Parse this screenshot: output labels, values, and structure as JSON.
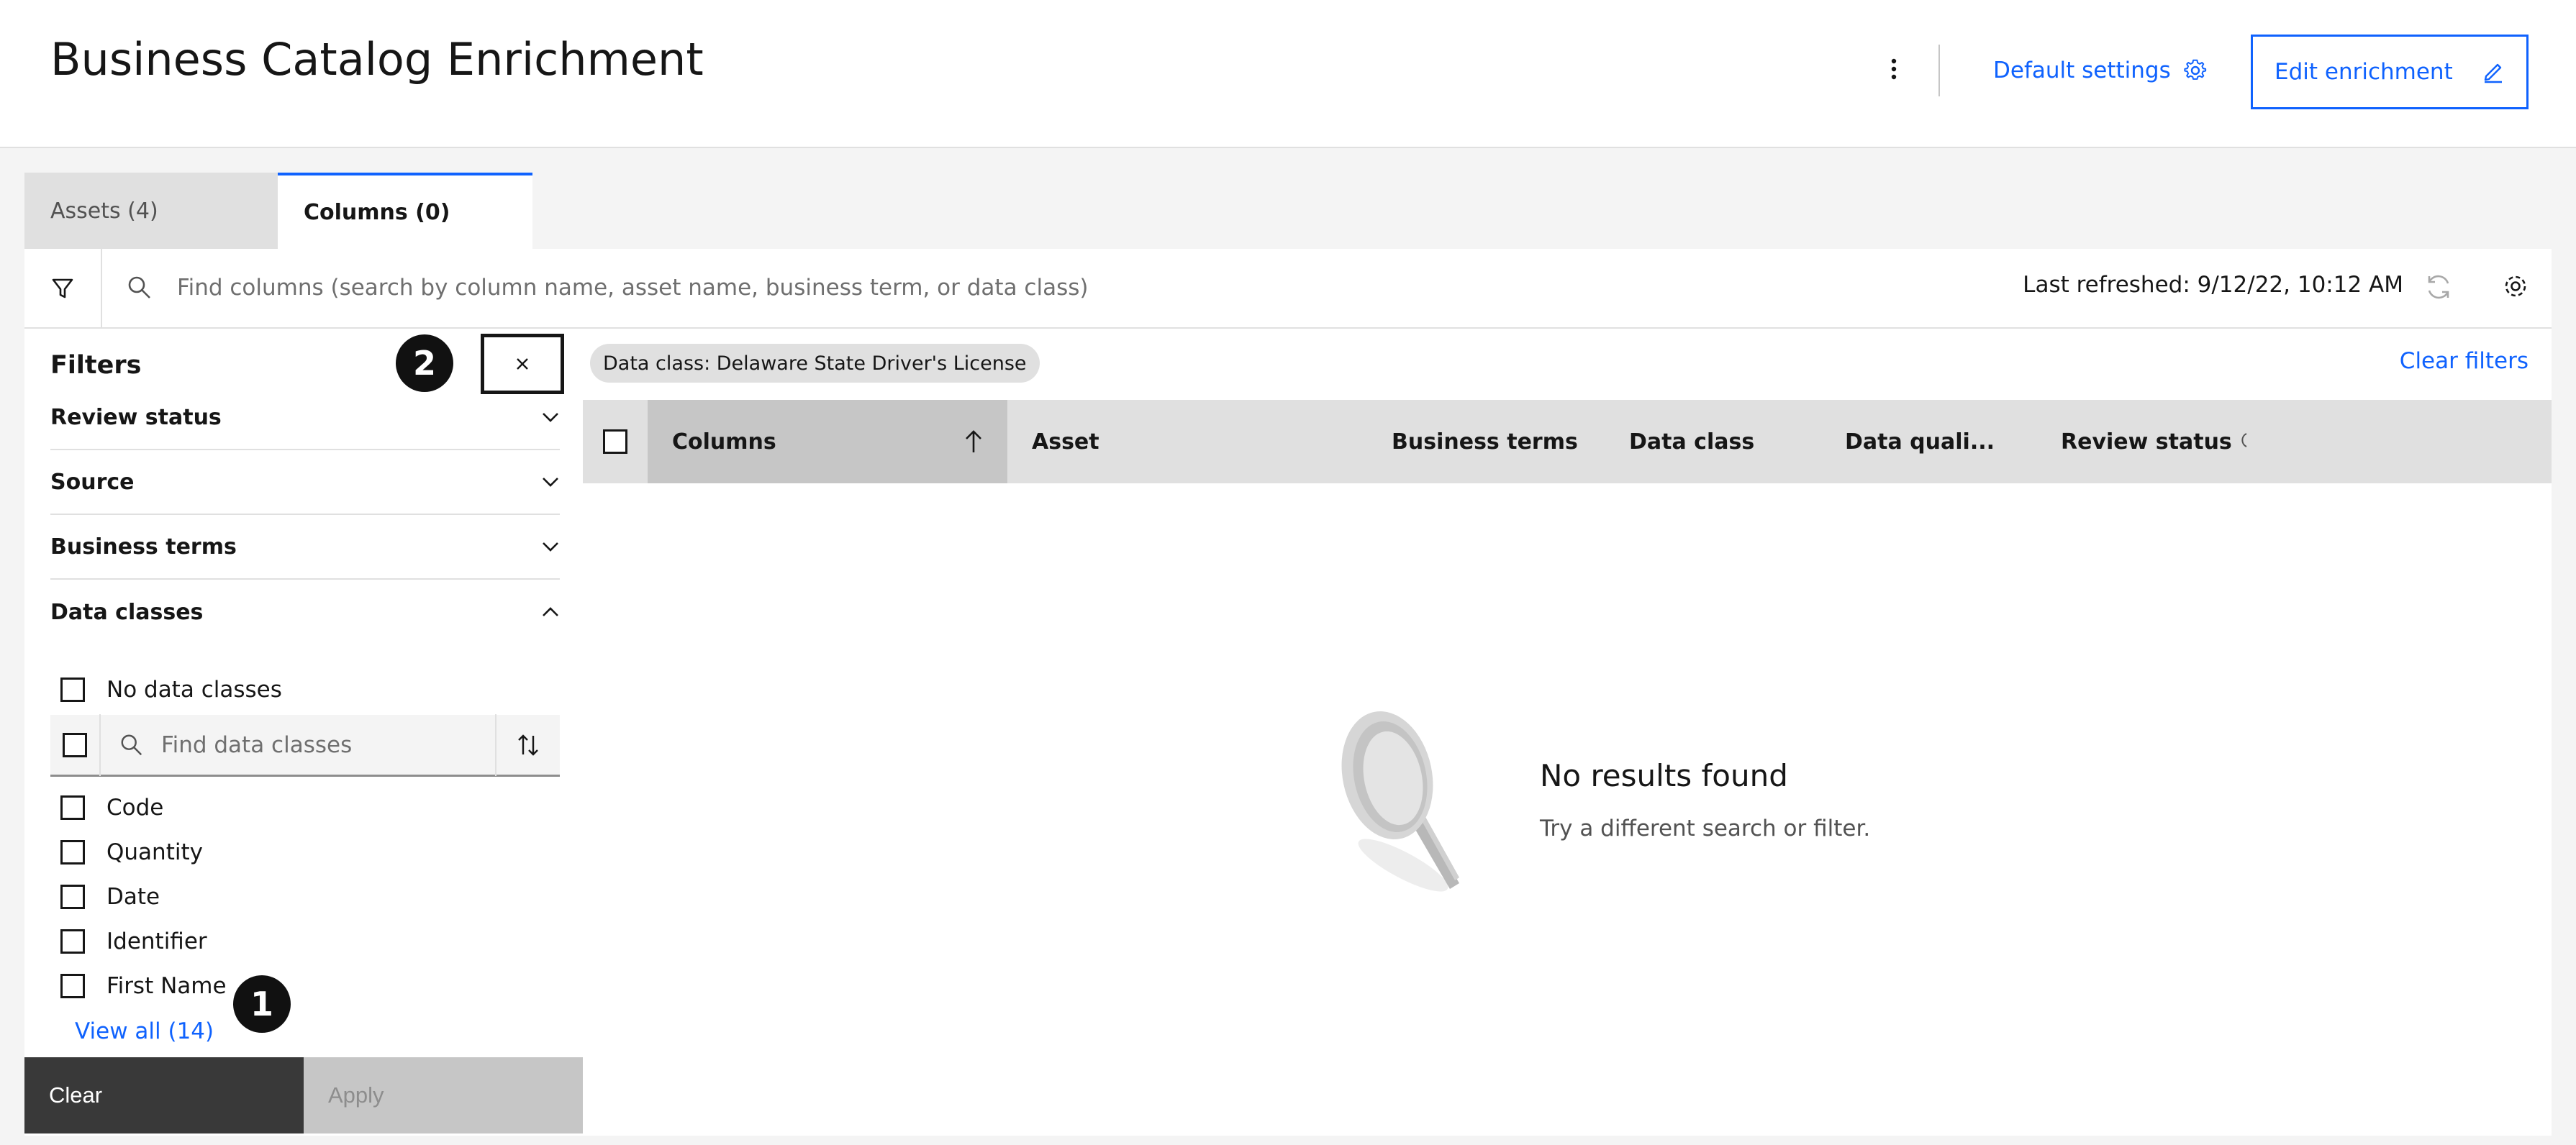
{
  "header": {
    "title": "Business Catalog Enrichment",
    "default_settings_label": "Default settings",
    "edit_enrichment_label": "Edit enrichment"
  },
  "tabs": [
    {
      "label": "Assets (4)",
      "active": false
    },
    {
      "label": "Columns (0)",
      "active": true
    }
  ],
  "toolbar": {
    "search_placeholder": "Find columns (search by column name, asset name, business term, or data class)",
    "last_refreshed": "Last refreshed: 9/12/22, 10:12 AM"
  },
  "filters": {
    "title": "Filters",
    "sections": [
      {
        "label": "Review status",
        "expanded": false
      },
      {
        "label": "Source",
        "expanded": false
      },
      {
        "label": "Business terms",
        "expanded": false
      },
      {
        "label": "Data classes",
        "expanded": true
      }
    ],
    "no_data_classes_label": "No data classes",
    "data_class_search_placeholder": "Find data classes",
    "data_class_options": [
      "Code",
      "Quantity",
      "Date",
      "Identifier",
      "First Name"
    ],
    "view_all_label": "View all (14)",
    "clear_label": "Clear",
    "apply_label": "Apply"
  },
  "callouts": [
    "1",
    "2"
  ],
  "active_filter_tag": "Data class: Delaware State Driver's License",
  "clear_filters_label": "Clear filters",
  "table": {
    "headers": [
      "Columns",
      "Asset",
      "Business terms",
      "Data class",
      "Data quali...",
      "Review status"
    ],
    "sort_column": "Columns",
    "sort_direction": "ascending"
  },
  "empty_state": {
    "title": "No results found",
    "subtitle": "Try a different search or filter."
  },
  "colors": {
    "accent": "#0f62fe",
    "dark_button": "#393939",
    "disabled_button": "#c6c6c6"
  },
  "icons": [
    "kebab-menu-icon",
    "gear-icon",
    "edit-pencil-icon",
    "filter-funnel-icon",
    "search-icon",
    "refresh-icon",
    "close-icon",
    "chevron-down-icon",
    "chevron-up-icon",
    "sort-icon",
    "arrow-up-icon",
    "magnifier-illustration"
  ]
}
